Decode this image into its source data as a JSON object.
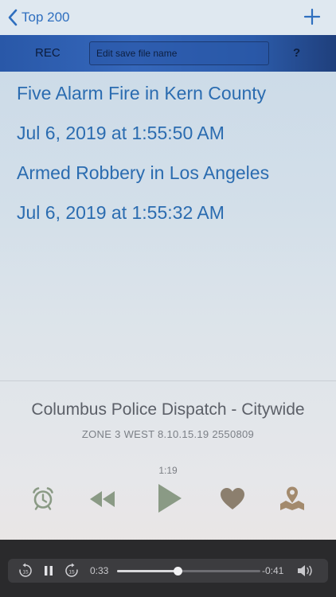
{
  "nav": {
    "back_label": "Top 200"
  },
  "recbar": {
    "rec_label": "REC",
    "filename_placeholder": "Edit save file name",
    "help_label": "?"
  },
  "recordings": [
    "Five Alarm Fire in Kern County",
    "Jul 6, 2019 at 1:55:50 AM",
    "Armed Robbery in Los Angeles",
    "Jul 6, 2019 at 1:55:32 AM"
  ],
  "station": {
    "name": "Columbus Police Dispatch - Citywide",
    "subtitle": "ZONE 3 WEST 8.10.15.19 2550809",
    "timer": "1:19"
  },
  "player": {
    "elapsed": "0:33",
    "remaining": "-0:41",
    "progress_fraction": 0.42,
    "skip_back_seconds": "15",
    "skip_forward_seconds": "15"
  },
  "icons": {
    "back": "chevron-left-icon",
    "add": "plus-icon",
    "alarm": "alarm-clock-icon",
    "rewind": "rewind-icon",
    "play": "play-icon",
    "favorite": "heart-icon",
    "map": "map-pin-icon",
    "volume": "speaker-icon"
  },
  "colors": {
    "accent_blue": "#2b6cb0",
    "rec_bar": "#3567bb",
    "control_green": "#8a9a85",
    "control_brown": "#8c7f6e",
    "player_bg": "#2a2a2c"
  }
}
